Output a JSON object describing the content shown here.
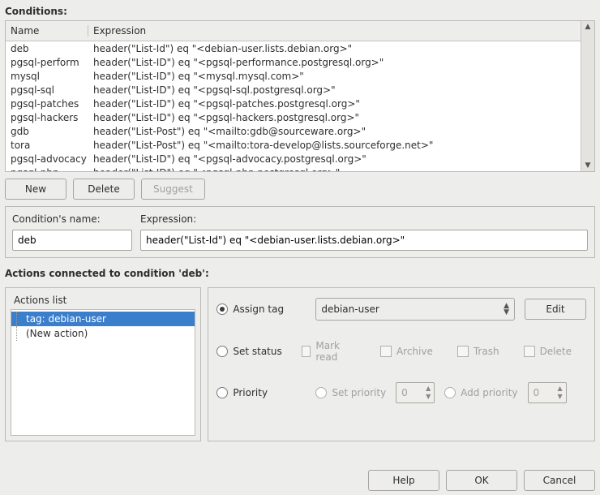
{
  "conditions": {
    "title": "Conditions:",
    "columns": {
      "name": "Name",
      "expression": "Expression"
    },
    "rows": [
      {
        "name": "deb",
        "expr": "header(\"List-Id\") eq \"<debian-user.lists.debian.org>\""
      },
      {
        "name": "pgsql-perform",
        "expr": "header(\"List-ID\") eq \"<pgsql-performance.postgresql.org>\""
      },
      {
        "name": "mysql",
        "expr": "header(\"List-ID\") eq \"<mysql.mysql.com>\""
      },
      {
        "name": "pgsql-sql",
        "expr": "header(\"List-ID\") eq \"<pgsql-sql.postgresql.org>\""
      },
      {
        "name": "pgsql-patches",
        "expr": "header(\"List-ID\") eq \"<pgsql-patches.postgresql.org>\""
      },
      {
        "name": "pgsql-hackers",
        "expr": "header(\"List-ID\") eq \"<pgsql-hackers.postgresql.org>\""
      },
      {
        "name": "gdb",
        "expr": "header(\"List-Post\") eq \"<mailto:gdb@sourceware.org>\""
      },
      {
        "name": "tora",
        "expr": "header(\"List-Post\") eq \"<mailto:tora-develop@lists.sourceforge.net>\""
      },
      {
        "name": "pgsql-advocacy",
        "expr": "header(\"List-ID\") eq \"<pgsql-advocacy.postgresql.org>\""
      },
      {
        "name": "pgsql-php",
        "expr": "header(\"List-ID\") eq \"<pgsql-php.postgresql.org>\""
      }
    ],
    "buttons": {
      "new": "New",
      "delete": "Delete",
      "suggest": "Suggest"
    }
  },
  "editor": {
    "name_label": "Condition's name:",
    "expr_label": "Expression:",
    "name_value": "deb",
    "expr_value": "header(\"List-Id\") eq \"<debian-user.lists.debian.org>\""
  },
  "actions": {
    "title": "Actions connected to condition 'deb':",
    "list_title": "Actions list",
    "items": [
      {
        "label": "tag: debian-user",
        "selected": true
      },
      {
        "label": "(New action)",
        "selected": false
      }
    ],
    "assign_tag": {
      "label": "Assign tag",
      "value": "debian-user",
      "edit": "Edit"
    },
    "set_status": {
      "label": "Set status",
      "mark_read": "Mark read",
      "archive": "Archive",
      "trash": "Trash",
      "delete": "Delete"
    },
    "priority": {
      "label": "Priority",
      "set_priority": "Set priority",
      "add_priority": "Add priority",
      "set_val": "0",
      "add_val": "0"
    }
  },
  "footer": {
    "help": "Help",
    "ok": "OK",
    "cancel": "Cancel"
  }
}
